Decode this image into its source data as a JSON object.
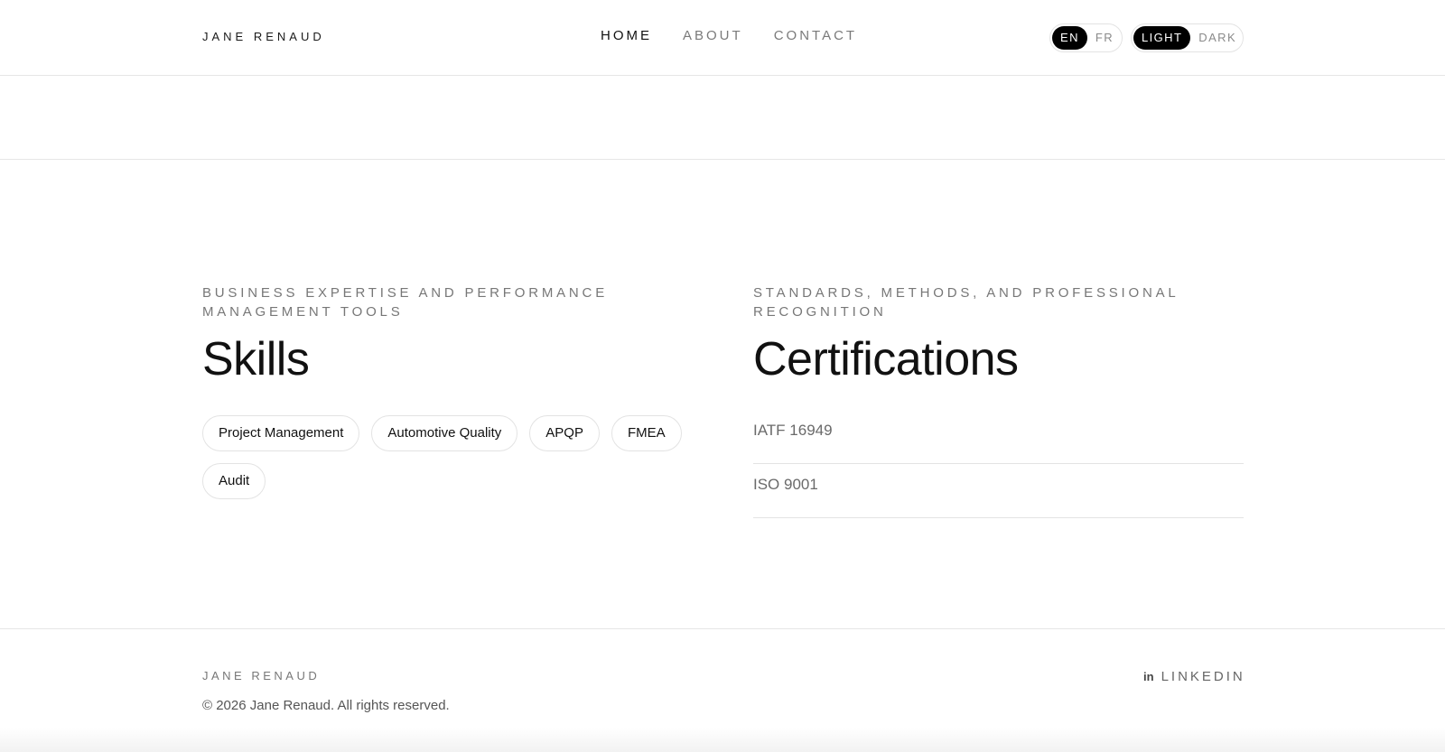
{
  "header": {
    "brand": "JANE RENAUD",
    "nav": [
      {
        "label": "HOME",
        "active": true
      },
      {
        "label": "ABOUT",
        "active": false
      },
      {
        "label": "CONTACT",
        "active": false
      }
    ],
    "language": {
      "options": [
        "EN",
        "FR"
      ],
      "selected": "EN"
    },
    "theme": {
      "options": [
        "LIGHT",
        "DARK"
      ],
      "selected": "LIGHT"
    }
  },
  "skills": {
    "eyebrow": "BUSINESS EXPERTISE AND PERFORMANCE MANAGEMENT TOOLS",
    "title": "Skills",
    "items": [
      "Project Management",
      "Automotive Quality",
      "APQP",
      "FMEA",
      "Audit"
    ]
  },
  "certifications": {
    "eyebrow": "STANDARDS, METHODS, AND PROFESSIONAL RECOGNITION",
    "title": "Certifications",
    "items": [
      "IATF 16949",
      "ISO 9001"
    ]
  },
  "footer": {
    "brand": "JANE RENAUD",
    "copyright": "© 2026 Jane Renaud. All rights reserved.",
    "link_label": "LINKEDIN",
    "link_icon": "linkedin-icon",
    "link_icon_glyph": "in"
  },
  "colors": {
    "accent": "#000000",
    "muted": "#777777",
    "border": "#e3e3e3"
  }
}
